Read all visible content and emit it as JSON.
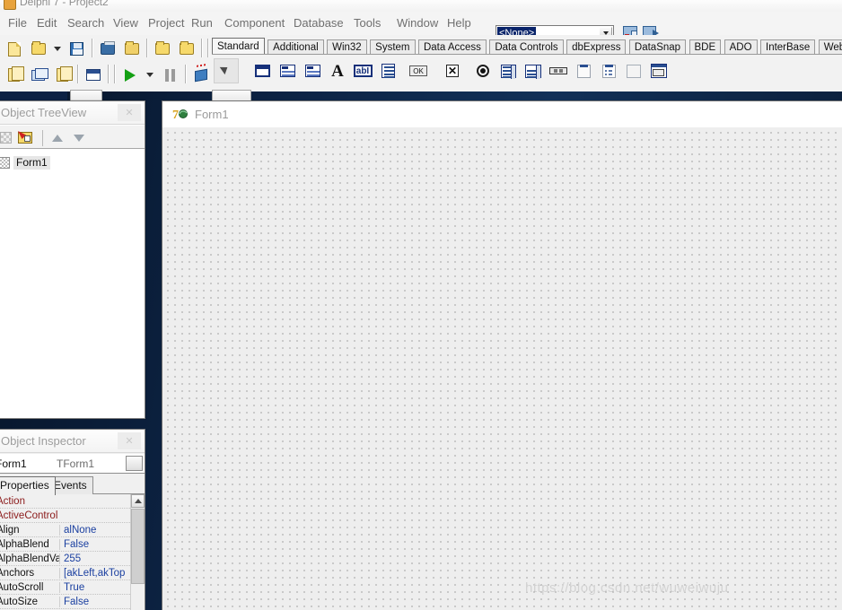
{
  "window": {
    "title": "Delphi 7 - Project2",
    "app_icon": "delphi-icon"
  },
  "menubar": {
    "items": [
      {
        "label": "File"
      },
      {
        "label": "Edit"
      },
      {
        "label": "Search"
      },
      {
        "label": "View"
      },
      {
        "label": "Project"
      },
      {
        "label": "Run"
      },
      {
        "label": "Component"
      },
      {
        "label": "Database"
      },
      {
        "label": "Tools"
      },
      {
        "label": "Window"
      },
      {
        "label": "Help"
      }
    ],
    "desktop_combo": {
      "value": "<None>",
      "icons": [
        "save-desktop-icon",
        "set-debug-desktop-icon"
      ]
    }
  },
  "toolbar": {
    "row1": [
      {
        "name": "new-item-button",
        "icon": "new-document-icon"
      },
      {
        "name": "open-button",
        "icon": "open-folder-icon"
      },
      {
        "name": "open-dropdown-button",
        "icon": "chevron-down-icon"
      },
      {
        "name": "save-button",
        "icon": "floppy-disk-icon"
      },
      {
        "name": "save-all-button",
        "icon": "save-all-icon"
      },
      {
        "name": "open-project-button",
        "icon": "open-project-icon"
      },
      {
        "name": "add-file-to-project-button",
        "icon": "add-file-icon"
      },
      {
        "name": "remove-file-from-project-button",
        "icon": "remove-file-icon"
      },
      {
        "name": "help-contents-button",
        "icon": "book-icon"
      }
    ],
    "row2": [
      {
        "name": "view-unit-button",
        "icon": "view-unit-icon"
      },
      {
        "name": "view-form-button",
        "icon": "view-form-icon"
      },
      {
        "name": "toggle-form-unit-button",
        "icon": "toggle-form-unit-icon"
      },
      {
        "name": "new-form-button",
        "icon": "new-form-icon"
      },
      {
        "name": "run-button",
        "icon": "run-triangle-icon"
      },
      {
        "name": "run-dropdown-button",
        "icon": "chevron-down-icon"
      },
      {
        "name": "pause-button",
        "icon": "pause-icon"
      },
      {
        "name": "trace-into-button",
        "icon": "trace-into-icon"
      },
      {
        "name": "step-over-button",
        "icon": "step-over-icon"
      }
    ]
  },
  "palette": {
    "tabs": [
      {
        "label": "Standard",
        "active": true
      },
      {
        "label": "Additional",
        "active": false
      },
      {
        "label": "Win32",
        "active": false
      },
      {
        "label": "System",
        "active": false
      },
      {
        "label": "Data Access",
        "active": false
      },
      {
        "label": "Data Controls",
        "active": false
      },
      {
        "label": "dbExpress",
        "active": false
      },
      {
        "label": "DataSnap",
        "active": false
      },
      {
        "label": "BDE",
        "active": false
      },
      {
        "label": "ADO",
        "active": false
      },
      {
        "label": "InterBase",
        "active": false
      },
      {
        "label": "WebServices",
        "active": false
      }
    ],
    "components": [
      {
        "name": "pointer-tool",
        "icon": "arrow-cursor-icon",
        "selected": true
      },
      {
        "name": "frames-component",
        "icon": "frames-icon"
      },
      {
        "name": "mainmenu-component",
        "icon": "mainmenu-icon"
      },
      {
        "name": "popupmenu-component",
        "icon": "popupmenu-icon"
      },
      {
        "name": "label-component",
        "icon": "label-A-icon"
      },
      {
        "name": "edit-component",
        "icon": "edit-abI-icon",
        "glyph": "abI"
      },
      {
        "name": "memo-component",
        "icon": "memo-icon"
      },
      {
        "name": "button-component",
        "icon": "button-ok-icon",
        "glyph": "OK"
      },
      {
        "name": "checkbox-component",
        "icon": "checkbox-icon",
        "glyph": "✕"
      },
      {
        "name": "radiobutton-component",
        "icon": "radiobutton-icon"
      },
      {
        "name": "listbox-component",
        "icon": "listbox-icon"
      },
      {
        "name": "combobox-component",
        "icon": "combobox-icon"
      },
      {
        "name": "scrollbar-component",
        "icon": "scrollbar-icon"
      },
      {
        "name": "groupbox-component",
        "icon": "groupbox-icon"
      },
      {
        "name": "radiogroup-component",
        "icon": "radiogroup-icon"
      },
      {
        "name": "panel-component",
        "icon": "panel-icon"
      },
      {
        "name": "actionlist-component",
        "icon": "actionlist-icon"
      }
    ]
  },
  "object_treeview": {
    "title": "Object TreeView",
    "close_label": "✕",
    "toolbar": [
      {
        "name": "otv-grid-button",
        "icon": "grid-icon"
      },
      {
        "name": "otv-component-button",
        "icon": "component-icon"
      },
      {
        "name": "otv-move-up-button",
        "icon": "arrow-up-icon"
      },
      {
        "name": "otv-move-down-button",
        "icon": "arrow-down-icon"
      }
    ],
    "nodes": [
      {
        "label": "Form1",
        "icon": "form-node-icon",
        "selected": true
      }
    ]
  },
  "object_inspector": {
    "title": "Object Inspector",
    "close_label": "✕",
    "selector": {
      "name": "Form1",
      "class": "TForm1"
    },
    "tabs": [
      {
        "label": "Properties",
        "active": true
      },
      {
        "label": "Events",
        "active": false
      }
    ],
    "properties": [
      {
        "name": "Action",
        "value": "",
        "nested": true
      },
      {
        "name": "ActiveControl",
        "value": "",
        "nested": true
      },
      {
        "name": "Align",
        "value": "alNone",
        "nested": false
      },
      {
        "name": "AlphaBlend",
        "value": "False",
        "nested": false
      },
      {
        "name": "AlphaBlendValu",
        "value": "255",
        "nested": false
      },
      {
        "name": "Anchors",
        "value": "[akLeft,akTop",
        "nested": false
      },
      {
        "name": "AutoScroll",
        "value": "True",
        "nested": false
      },
      {
        "name": "AutoSize",
        "value": "False",
        "nested": false
      }
    ]
  },
  "form_designer": {
    "title": "Form1",
    "icon": "delphi-form-icon",
    "watermark": "https://blog.csdn.net/wuweiwuju"
  },
  "colors": {
    "desktop_background": "#0d2547",
    "panel_background": "#f0f0f0",
    "property_value": "#1a3fa0",
    "nested_property": "#8b1a1a",
    "form_canvas": "#eeeeee",
    "selection_blue": "#0a246a"
  }
}
